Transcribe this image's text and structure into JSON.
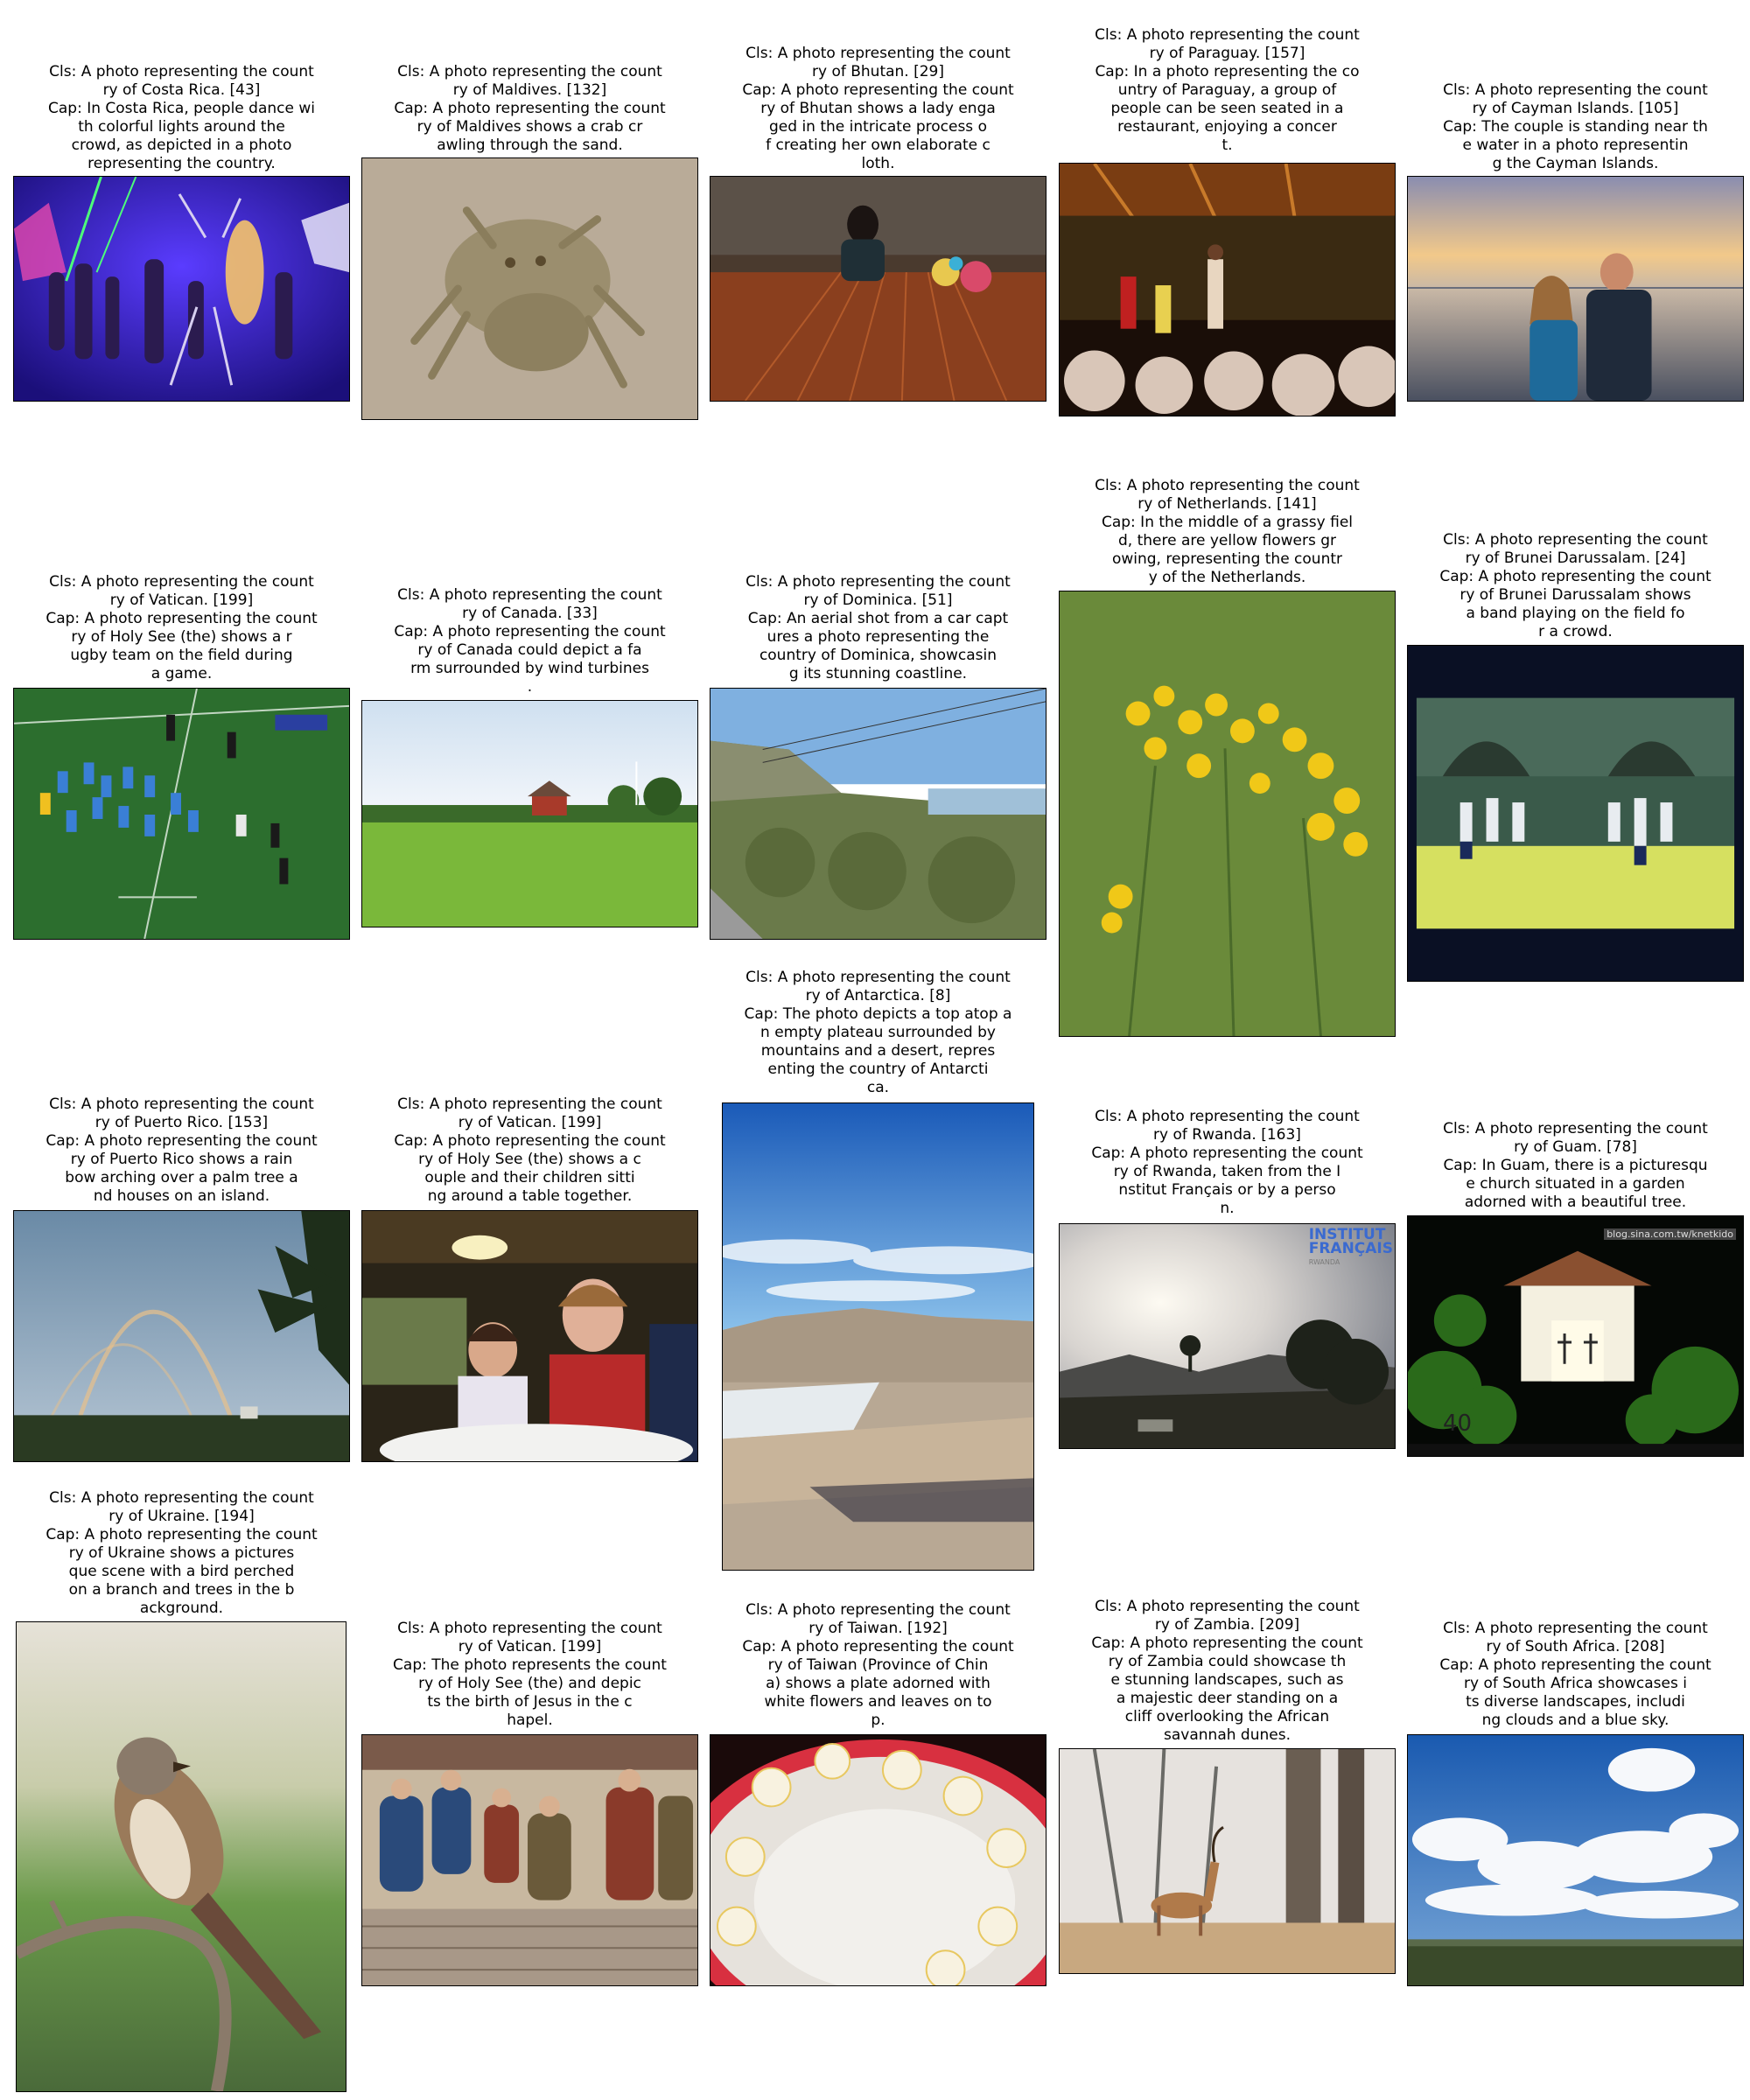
{
  "figure": {
    "panels": [
      {
        "cls": [
          "Cls: A photo representing the count",
          "ry of Costa Rica. [43]"
        ],
        "cap": [
          "Cap: In Costa Rica, people dance wi",
          "th colorful lights around the",
          "crowd, as depicted in a photo",
          "representing the country."
        ]
      },
      {
        "cls": [
          "Cls: A photo representing the count",
          "ry of Maldives. [132]"
        ],
        "cap": [
          "Cap: A photo representing the count",
          "ry of Maldives shows a crab cr",
          "awling through the sand."
        ]
      },
      {
        "cls": [
          "Cls: A photo representing the count",
          "ry of Bhutan. [29]"
        ],
        "cap": [
          "Cap: A photo representing the count",
          "ry of Bhutan shows a lady enga",
          "ged in the intricate process o",
          "f creating her own elaborate c",
          "loth."
        ]
      },
      {
        "cls": [
          "Cls: A photo representing the count",
          "ry of Paraguay. [157]"
        ],
        "cap": [
          "Cap: In a photo representing the co",
          "untry of Paraguay, a group of",
          "people can be seen seated in a",
          "restaurant, enjoying a concer",
          "t."
        ]
      },
      {
        "cls": [
          "Cls: A photo representing the count",
          "ry of Cayman Islands. [105]"
        ],
        "cap": [
          "Cap: The couple is standing near th",
          "e water in a photo representin",
          "g the Cayman Islands."
        ]
      },
      {
        "cls": [
          "Cls: A photo representing the count",
          "ry of Vatican. [199]"
        ],
        "cap": [
          "Cap: A photo representing the count",
          "ry of Holy See (the) shows a r",
          "ugby team on the field during",
          "a game."
        ]
      },
      {
        "cls": [
          "Cls: A photo representing the count",
          "ry of Canada. [33]"
        ],
        "cap": [
          "Cap: A photo representing the count",
          "ry of Canada could depict a fa",
          "rm surrounded by wind turbines",
          "."
        ]
      },
      {
        "cls": [
          "Cls: A photo representing the count",
          "ry of Dominica. [51]"
        ],
        "cap": [
          "Cap: An aerial shot from a car capt",
          "ures a photo representing the",
          "country of Dominica, showcasin",
          "g its stunning coastline."
        ]
      },
      {
        "cls": [
          "Cls: A photo representing the count",
          "ry of Netherlands. [141]"
        ],
        "cap": [
          "Cap: In the middle of a grassy fiel",
          "d, there are yellow flowers gr",
          "owing, representing the countr",
          "y of the Netherlands."
        ]
      },
      {
        "cls": [
          "Cls: A photo representing the count",
          "ry of Brunei Darussalam. [24]"
        ],
        "cap": [
          "Cap: A photo representing the count",
          "ry of Brunei Darussalam shows",
          "a band playing on the field fo",
          "r a crowd."
        ]
      },
      {
        "cls": [
          "Cls: A photo representing the count",
          "ry of Puerto Rico. [153]"
        ],
        "cap": [
          "Cap: A photo representing the count",
          "ry of Puerto Rico shows a rain",
          "bow arching over a palm tree a",
          "nd houses on an island."
        ]
      },
      {
        "cls": [
          "Cls: A photo representing the count",
          "ry of Vatican. [199]"
        ],
        "cap": [
          "Cap: A photo representing the count",
          "ry of Holy See (the) shows a c",
          "ouple and their children sitti",
          "ng around a table together."
        ]
      },
      {
        "cls": [
          "Cls: A photo representing the count",
          "ry of Antarctica. [8]"
        ],
        "cap": [
          "Cap: The photo depicts a top atop a",
          "n empty plateau surrounded by",
          "mountains and a desert, repres",
          "enting the country of Antarcti",
          "ca."
        ]
      },
      {
        "cls": [
          "Cls: A photo representing the count",
          "ry of Rwanda. [163]"
        ],
        "cap": [
          "Cap: A photo representing the count",
          "ry of Rwanda, taken from the I",
          "nstitut Français or by a perso",
          "n."
        ]
      },
      {
        "cls": [
          "Cls: A photo representing the count",
          "ry of Guam. [78]"
        ],
        "cap": [
          "Cap: In Guam, there is a picturesqu",
          "e church situated in a garden",
          "adorned with a beautiful tree."
        ]
      },
      {
        "cls": [
          "Cls: A photo representing the count",
          "ry of Ukraine. [194]"
        ],
        "cap": [
          "Cap: A photo representing the count",
          "ry of Ukraine shows a pictures",
          "que scene with a bird perched",
          "on a branch and trees in the b",
          "ackground."
        ]
      },
      {
        "cls": [
          "Cls: A photo representing the count",
          "ry of Vatican. [199]"
        ],
        "cap": [
          "Cap: The photo represents the count",
          "ry of Holy See (the) and depic",
          "ts the birth of Jesus in the c",
          "hapel."
        ]
      },
      {
        "cls": [
          "Cls: A photo representing the count",
          "ry of Taiwan. [192]"
        ],
        "cap": [
          "Cap: A photo representing the count",
          "ry of Taiwan (Province of Chin",
          "a) shows a plate adorned with",
          "white flowers and leaves on to",
          "p."
        ]
      },
      {
        "cls": [
          "Cls: A photo representing the count",
          "ry of Zambia. [209]"
        ],
        "cap": [
          "Cap: A photo representing the count",
          "ry of Zambia could showcase th",
          "e stunning landscapes, such as",
          "a majestic deer standing on a",
          "cliff overlooking the African",
          "savannah dunes."
        ]
      },
      {
        "cls": [
          "Cls: A photo representing the count",
          "ry of South Africa. [208]"
        ],
        "cap": [
          "Cap: A photo representing the count",
          "ry of South Africa showcases i",
          "ts diverse landscapes, includi",
          "ng clouds and a blue sky."
        ]
      }
    ],
    "photo_texts": {
      "rwanda_logo_line1": "INSTITUT",
      "rwanda_logo_line2": "FRANÇAIS",
      "rwanda_logo_line3": "RWANDA",
      "guam_watermark": "blog.sina.com.tw/knetkido",
      "guam_number": "40"
    }
  }
}
